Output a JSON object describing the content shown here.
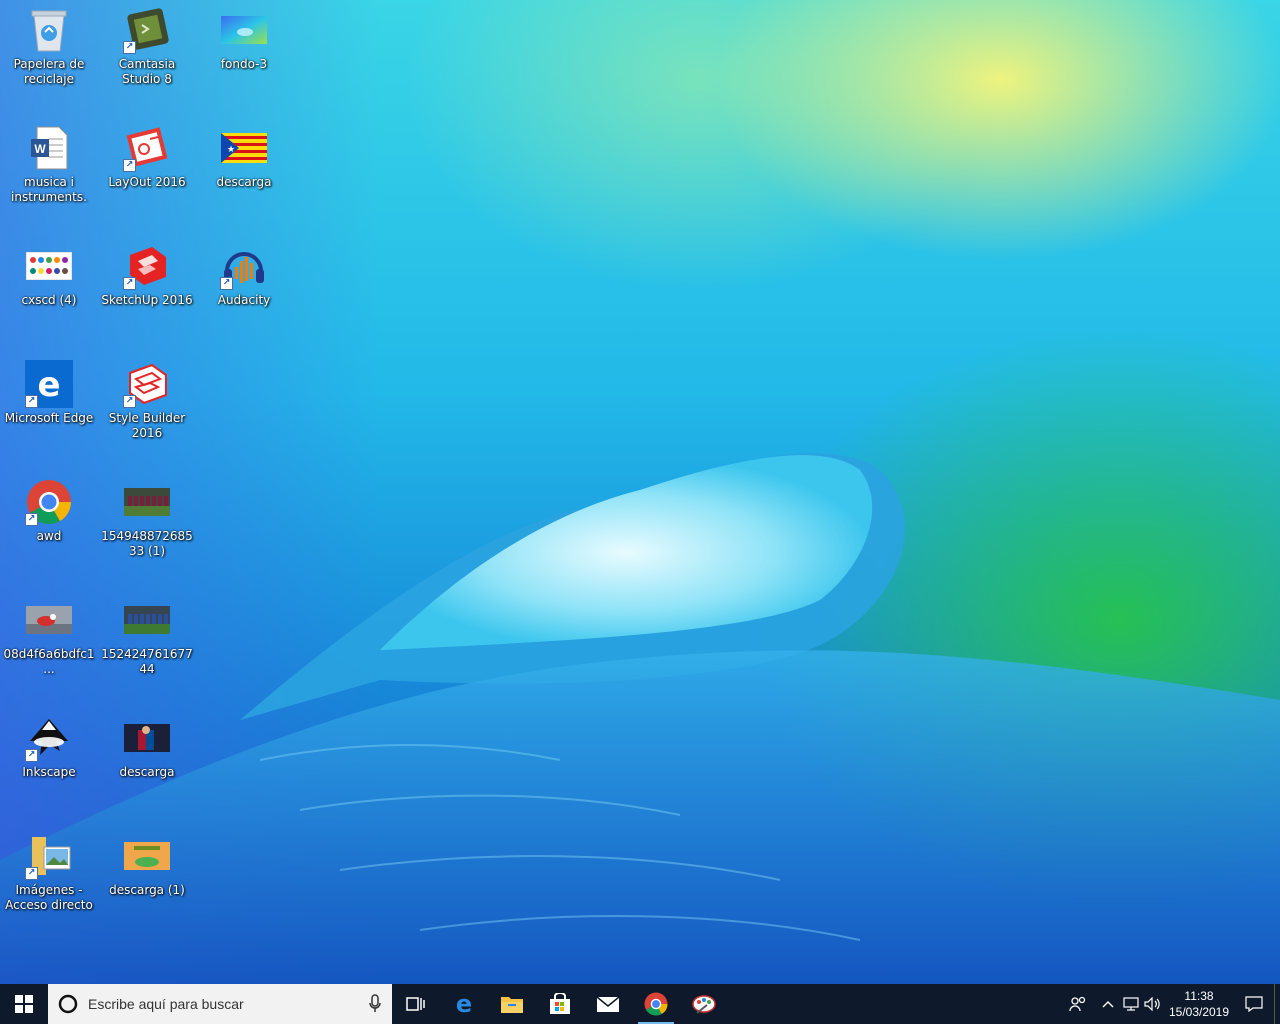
{
  "desktop": {
    "icons": [
      {
        "label": "Papelera de reciclaje",
        "icon": "recycle-bin-icon"
      },
      {
        "label": "Camtasia Studio 8",
        "icon": "camtasia-icon"
      },
      {
        "label": "fondo-3",
        "icon": "image-thumbnail-icon"
      },
      {
        "label": "musica i instruments.",
        "icon": "word-document-icon"
      },
      {
        "label": "LayOut 2016",
        "icon": "layout-icon"
      },
      {
        "label": "descarga",
        "icon": "flag-image-icon"
      },
      {
        "label": "cxscd (4)",
        "icon": "image-thumbnail-icon"
      },
      {
        "label": "SketchUp 2016",
        "icon": "sketchup-icon"
      },
      {
        "label": "Audacity",
        "icon": "audacity-icon"
      },
      {
        "label": "Microsoft Edge",
        "icon": "edge-icon"
      },
      {
        "label": "Style Builder 2016",
        "icon": "style-builder-icon"
      },
      {
        "label": "awd",
        "icon": "chrome-icon"
      },
      {
        "label": "15494887268533 (1)",
        "icon": "photo-thumbnail-icon"
      },
      {
        "label": "08d4f6a6bdfc1...",
        "icon": "photo-thumbnail-icon"
      },
      {
        "label": "15242476167744",
        "icon": "photo-thumbnail-icon"
      },
      {
        "label": "Inkscape",
        "icon": "inkscape-icon"
      },
      {
        "label": "descarga",
        "icon": "photo-thumbnail-icon"
      },
      {
        "label": "Imágenes - Acceso directo",
        "icon": "folder-shortcut-icon"
      },
      {
        "label": "descarga (1)",
        "icon": "photo-thumbnail-icon"
      }
    ]
  },
  "taskbar": {
    "search_placeholder": "Escribe aquí para buscar",
    "pinned": [
      "task-view-icon",
      "edge-icon",
      "file-explorer-icon",
      "store-icon",
      "mail-icon",
      "chrome-icon",
      "paint-icon"
    ],
    "clock_time": "11:38",
    "clock_date": "15/03/2019"
  },
  "colors": {
    "taskbar_bg": "#0e1a2b",
    "search_bg": "#f2f2f2",
    "accent": "#0078d7"
  }
}
